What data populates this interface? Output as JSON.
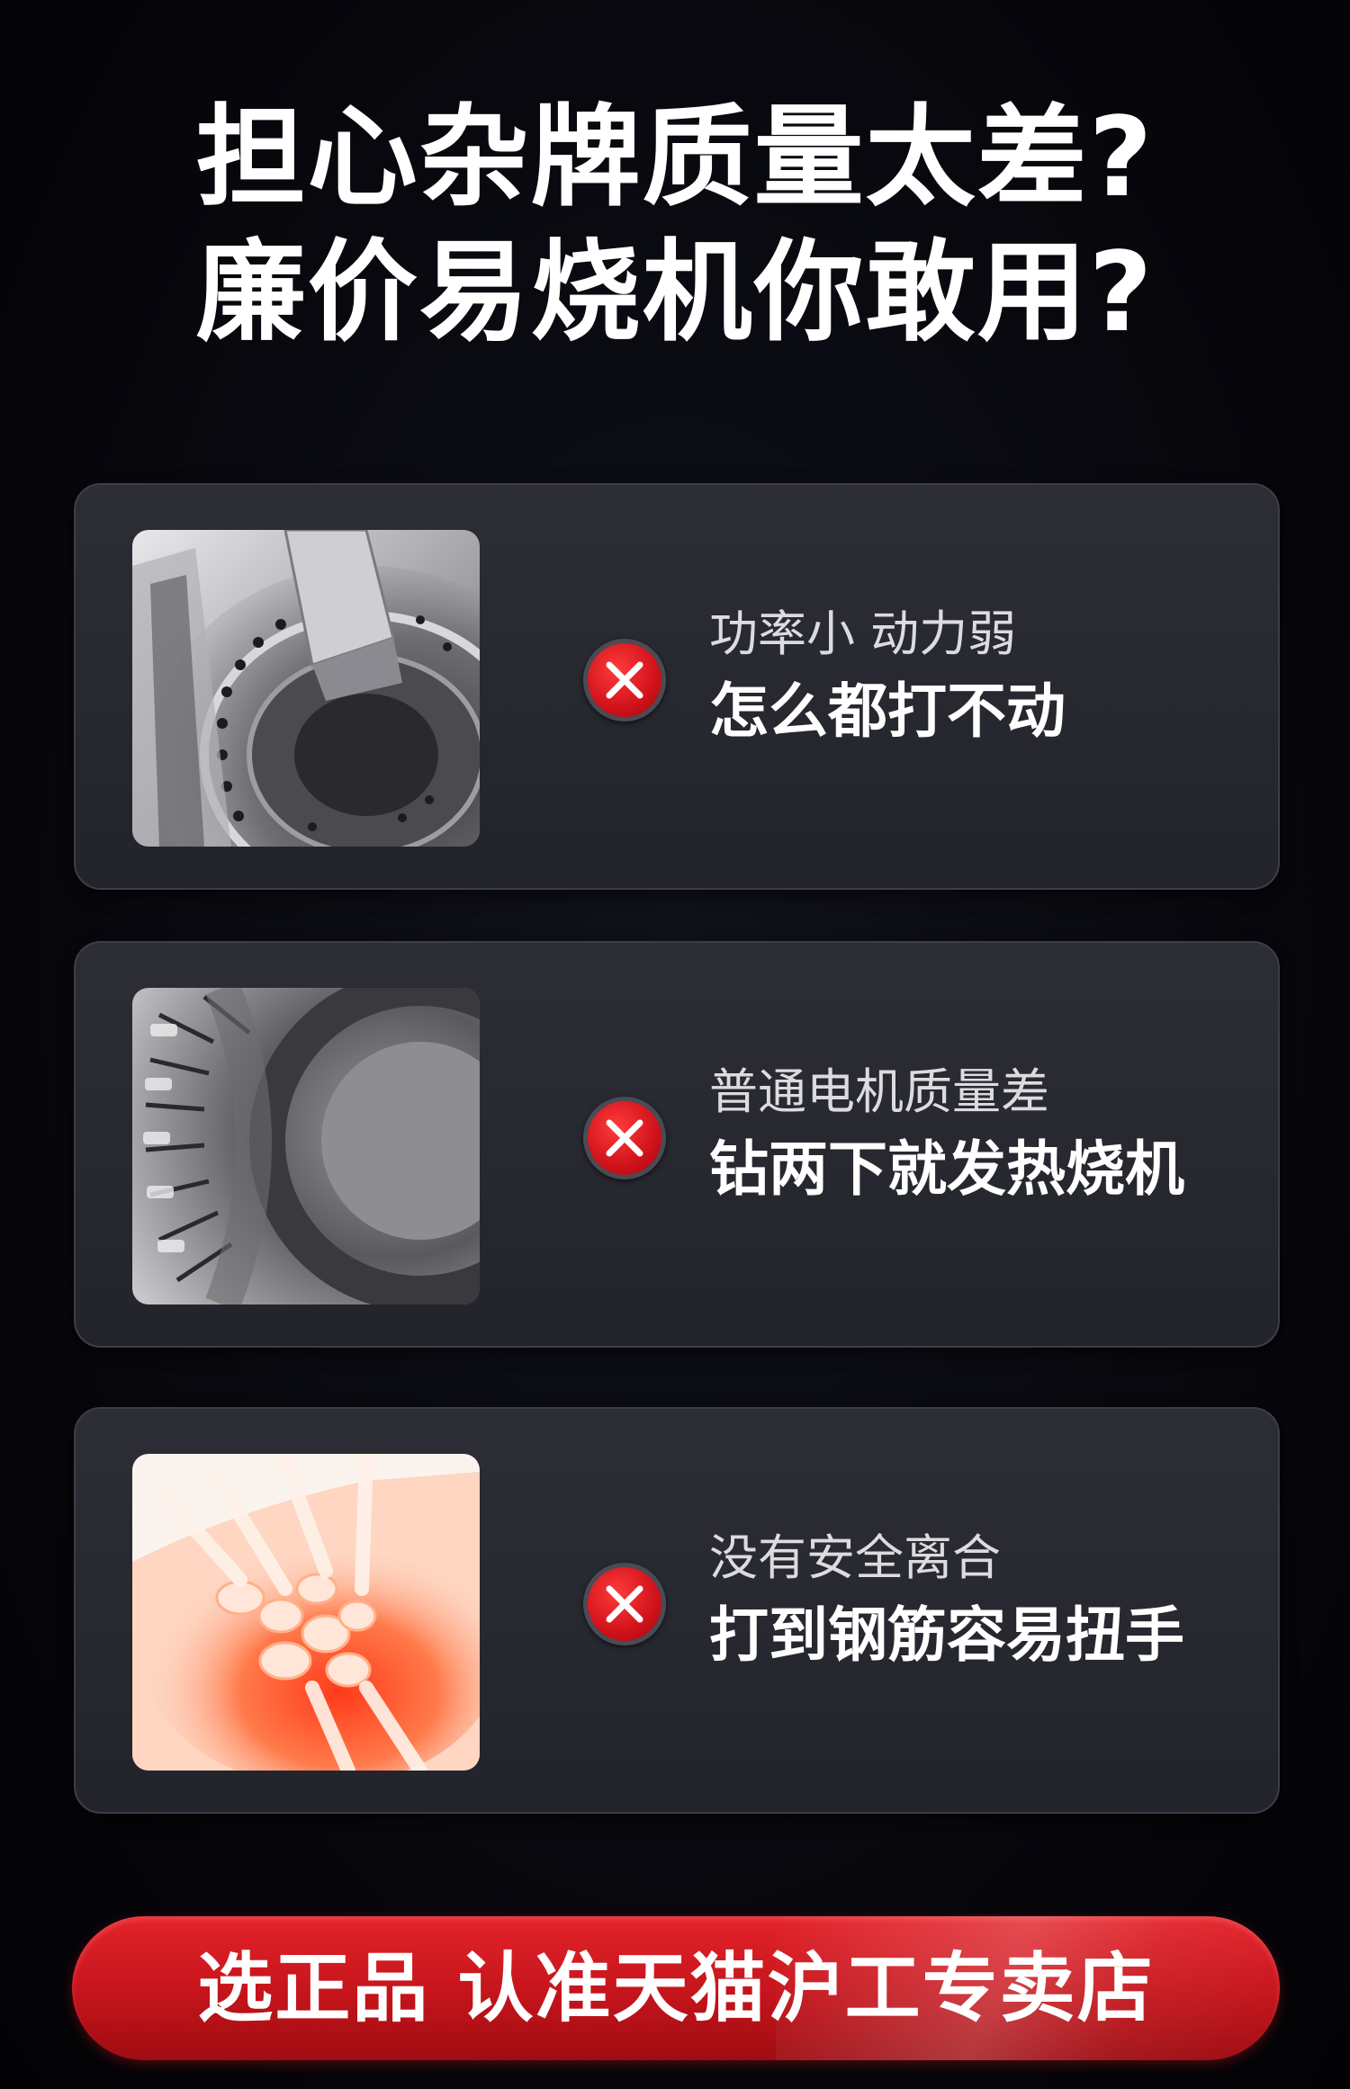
{
  "headline": {
    "line1": "担心杂牌质量太差?",
    "line2": "廉价易烧机你敢用?"
  },
  "cards": [
    {
      "image_icon": "drill-gear-mechanism-photo",
      "status_icon": "red-x-icon",
      "subtitle": "功率小 动力弱",
      "title": "怎么都打不动"
    },
    {
      "image_icon": "motor-coil-stator-photo",
      "status_icon": "red-x-icon",
      "subtitle": "普通电机质量差",
      "title": "钻两下就发热烧机"
    },
    {
      "image_icon": "injured-wrist-xray-photo",
      "status_icon": "red-x-icon",
      "subtitle": "没有安全离合",
      "title": "打到钢筋容易扭手"
    }
  ],
  "cta": {
    "label": "选正品 认准天猫沪工专卖店"
  },
  "colors": {
    "background": "#05050a",
    "card": "#2a2b33",
    "accent_red": "#d0121a",
    "text_primary": "#ffffff",
    "text_secondary": "#dcdce0"
  }
}
